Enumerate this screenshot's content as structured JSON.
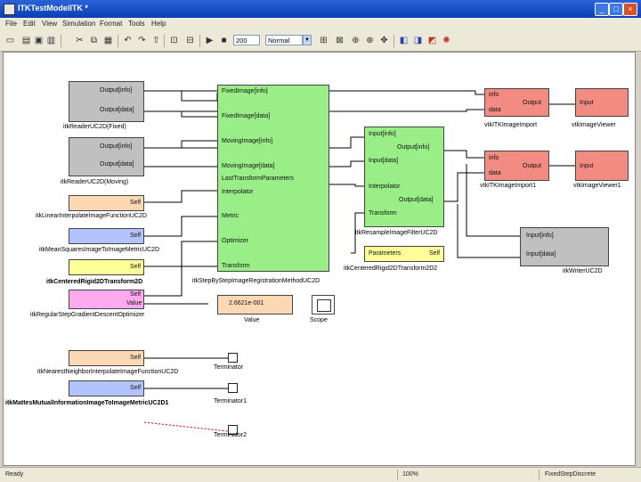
{
  "window": {
    "title": "ITKTestModelITK *",
    "minimize": "_",
    "maximize": "□",
    "close": "×"
  },
  "menu": [
    "File",
    "Edit",
    "View",
    "Simulation",
    "Format",
    "Tools",
    "Help"
  ],
  "toolbar": {
    "sim_time": "200",
    "sim_mode": "Normal"
  },
  "blocks": {
    "reader_fixed": {
      "port1": "Output[info]",
      "port2": "Output[data]",
      "name": "itkReaderUC2D(Fixed)"
    },
    "reader_moving": {
      "port1": "Output[info]",
      "port2": "Output[data]",
      "name": "itkReaderUC2D(Moving)"
    },
    "interp": {
      "port": "Self",
      "name": "itkLinearInterpolateImageFunctionUC2D"
    },
    "metric": {
      "port": "Self",
      "name": "itkMeanSquaresImageToImageMetricUC2D"
    },
    "transform": {
      "port": "Self",
      "name": "itkCenteredRigid2DTransform2D"
    },
    "optimizer": {
      "port1": "Self",
      "port2": "Value",
      "name": "itkRegularStepGradientDescentOptimizer"
    },
    "registration": {
      "ports": [
        "FixedImage[info]",
        "FixedImage[data]",
        "MovingImage[info]",
        "MovingImage[data]",
        "LastTransformParameters",
        "Interpolator",
        "Metric",
        "Optimizer",
        "Transform"
      ],
      "name": "itkStepByStepImageRegistrationMethodUC2D"
    },
    "resample": {
      "ports": [
        "Input[info]",
        "Output[info]",
        "Input[data]",
        "Interpolator",
        "Output[data]",
        "Transform"
      ],
      "name": "itkResampleImageFilterUC2D"
    },
    "centered2": {
      "port1": "Parameters",
      "port2": "Self",
      "name": "itkCenteredRigid2DTransform2D2"
    },
    "import1": {
      "in1": "info",
      "in2": "data",
      "out": "Output",
      "name": "vtkITKImageImport"
    },
    "import2": {
      "in1": "info",
      "in2": "data",
      "out": "Output",
      "name": "vtkITKImageImport1"
    },
    "viewer1": {
      "port": "Input",
      "name": "vtkImageViewer"
    },
    "viewer2": {
      "port": "Input",
      "name": "vtkImageViewer1"
    },
    "writer": {
      "port1": "Input[info]",
      "port2": "Input[data]",
      "name": "itkWriterUC2D"
    },
    "value": {
      "display": "2.6621e-001",
      "name": "Value"
    },
    "scope": {
      "name": "Scope"
    },
    "nn_interp": {
      "port": "Self",
      "name": "itkNearestNeighborInterpolateImageFunctionUC2D"
    },
    "mattes": {
      "port": "Self",
      "name": "itkMattesMutualInformationImageToImageMetricUC2D1"
    },
    "term0": {
      "name": "Terminator"
    },
    "term1": {
      "name": "Terminator1"
    },
    "term2": {
      "name": "Terminator2"
    }
  },
  "status": {
    "state": "Ready",
    "zoom": "100%",
    "solver": "FixedStepDiscrete"
  }
}
